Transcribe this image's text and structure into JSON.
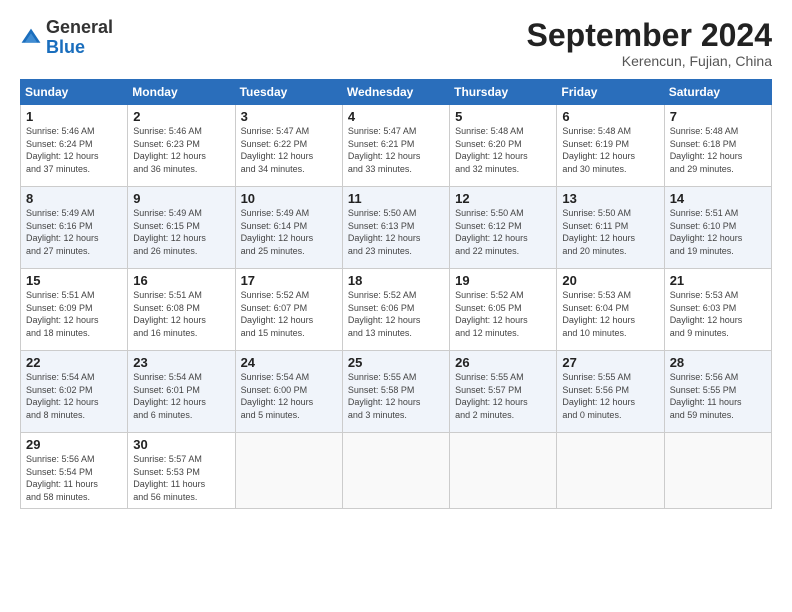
{
  "logo": {
    "general": "General",
    "blue": "Blue"
  },
  "header": {
    "month": "September 2024",
    "location": "Kerencun, Fujian, China"
  },
  "weekdays": [
    "Sunday",
    "Monday",
    "Tuesday",
    "Wednesday",
    "Thursday",
    "Friday",
    "Saturday"
  ],
  "weeks": [
    [
      {
        "day": "1",
        "info": "Sunrise: 5:46 AM\nSunset: 6:24 PM\nDaylight: 12 hours\nand 37 minutes."
      },
      {
        "day": "2",
        "info": "Sunrise: 5:46 AM\nSunset: 6:23 PM\nDaylight: 12 hours\nand 36 minutes."
      },
      {
        "day": "3",
        "info": "Sunrise: 5:47 AM\nSunset: 6:22 PM\nDaylight: 12 hours\nand 34 minutes."
      },
      {
        "day": "4",
        "info": "Sunrise: 5:47 AM\nSunset: 6:21 PM\nDaylight: 12 hours\nand 33 minutes."
      },
      {
        "day": "5",
        "info": "Sunrise: 5:48 AM\nSunset: 6:20 PM\nDaylight: 12 hours\nand 32 minutes."
      },
      {
        "day": "6",
        "info": "Sunrise: 5:48 AM\nSunset: 6:19 PM\nDaylight: 12 hours\nand 30 minutes."
      },
      {
        "day": "7",
        "info": "Sunrise: 5:48 AM\nSunset: 6:18 PM\nDaylight: 12 hours\nand 29 minutes."
      }
    ],
    [
      {
        "day": "8",
        "info": "Sunrise: 5:49 AM\nSunset: 6:16 PM\nDaylight: 12 hours\nand 27 minutes."
      },
      {
        "day": "9",
        "info": "Sunrise: 5:49 AM\nSunset: 6:15 PM\nDaylight: 12 hours\nand 26 minutes."
      },
      {
        "day": "10",
        "info": "Sunrise: 5:49 AM\nSunset: 6:14 PM\nDaylight: 12 hours\nand 25 minutes."
      },
      {
        "day": "11",
        "info": "Sunrise: 5:50 AM\nSunset: 6:13 PM\nDaylight: 12 hours\nand 23 minutes."
      },
      {
        "day": "12",
        "info": "Sunrise: 5:50 AM\nSunset: 6:12 PM\nDaylight: 12 hours\nand 22 minutes."
      },
      {
        "day": "13",
        "info": "Sunrise: 5:50 AM\nSunset: 6:11 PM\nDaylight: 12 hours\nand 20 minutes."
      },
      {
        "day": "14",
        "info": "Sunrise: 5:51 AM\nSunset: 6:10 PM\nDaylight: 12 hours\nand 19 minutes."
      }
    ],
    [
      {
        "day": "15",
        "info": "Sunrise: 5:51 AM\nSunset: 6:09 PM\nDaylight: 12 hours\nand 18 minutes."
      },
      {
        "day": "16",
        "info": "Sunrise: 5:51 AM\nSunset: 6:08 PM\nDaylight: 12 hours\nand 16 minutes."
      },
      {
        "day": "17",
        "info": "Sunrise: 5:52 AM\nSunset: 6:07 PM\nDaylight: 12 hours\nand 15 minutes."
      },
      {
        "day": "18",
        "info": "Sunrise: 5:52 AM\nSunset: 6:06 PM\nDaylight: 12 hours\nand 13 minutes."
      },
      {
        "day": "19",
        "info": "Sunrise: 5:52 AM\nSunset: 6:05 PM\nDaylight: 12 hours\nand 12 minutes."
      },
      {
        "day": "20",
        "info": "Sunrise: 5:53 AM\nSunset: 6:04 PM\nDaylight: 12 hours\nand 10 minutes."
      },
      {
        "day": "21",
        "info": "Sunrise: 5:53 AM\nSunset: 6:03 PM\nDaylight: 12 hours\nand 9 minutes."
      }
    ],
    [
      {
        "day": "22",
        "info": "Sunrise: 5:54 AM\nSunset: 6:02 PM\nDaylight: 12 hours\nand 8 minutes."
      },
      {
        "day": "23",
        "info": "Sunrise: 5:54 AM\nSunset: 6:01 PM\nDaylight: 12 hours\nand 6 minutes."
      },
      {
        "day": "24",
        "info": "Sunrise: 5:54 AM\nSunset: 6:00 PM\nDaylight: 12 hours\nand 5 minutes."
      },
      {
        "day": "25",
        "info": "Sunrise: 5:55 AM\nSunset: 5:58 PM\nDaylight: 12 hours\nand 3 minutes."
      },
      {
        "day": "26",
        "info": "Sunrise: 5:55 AM\nSunset: 5:57 PM\nDaylight: 12 hours\nand 2 minutes."
      },
      {
        "day": "27",
        "info": "Sunrise: 5:55 AM\nSunset: 5:56 PM\nDaylight: 12 hours\nand 0 minutes."
      },
      {
        "day": "28",
        "info": "Sunrise: 5:56 AM\nSunset: 5:55 PM\nDaylight: 11 hours\nand 59 minutes."
      }
    ],
    [
      {
        "day": "29",
        "info": "Sunrise: 5:56 AM\nSunset: 5:54 PM\nDaylight: 11 hours\nand 58 minutes."
      },
      {
        "day": "30",
        "info": "Sunrise: 5:57 AM\nSunset: 5:53 PM\nDaylight: 11 hours\nand 56 minutes."
      },
      {
        "day": "",
        "info": ""
      },
      {
        "day": "",
        "info": ""
      },
      {
        "day": "",
        "info": ""
      },
      {
        "day": "",
        "info": ""
      },
      {
        "day": "",
        "info": ""
      }
    ]
  ]
}
